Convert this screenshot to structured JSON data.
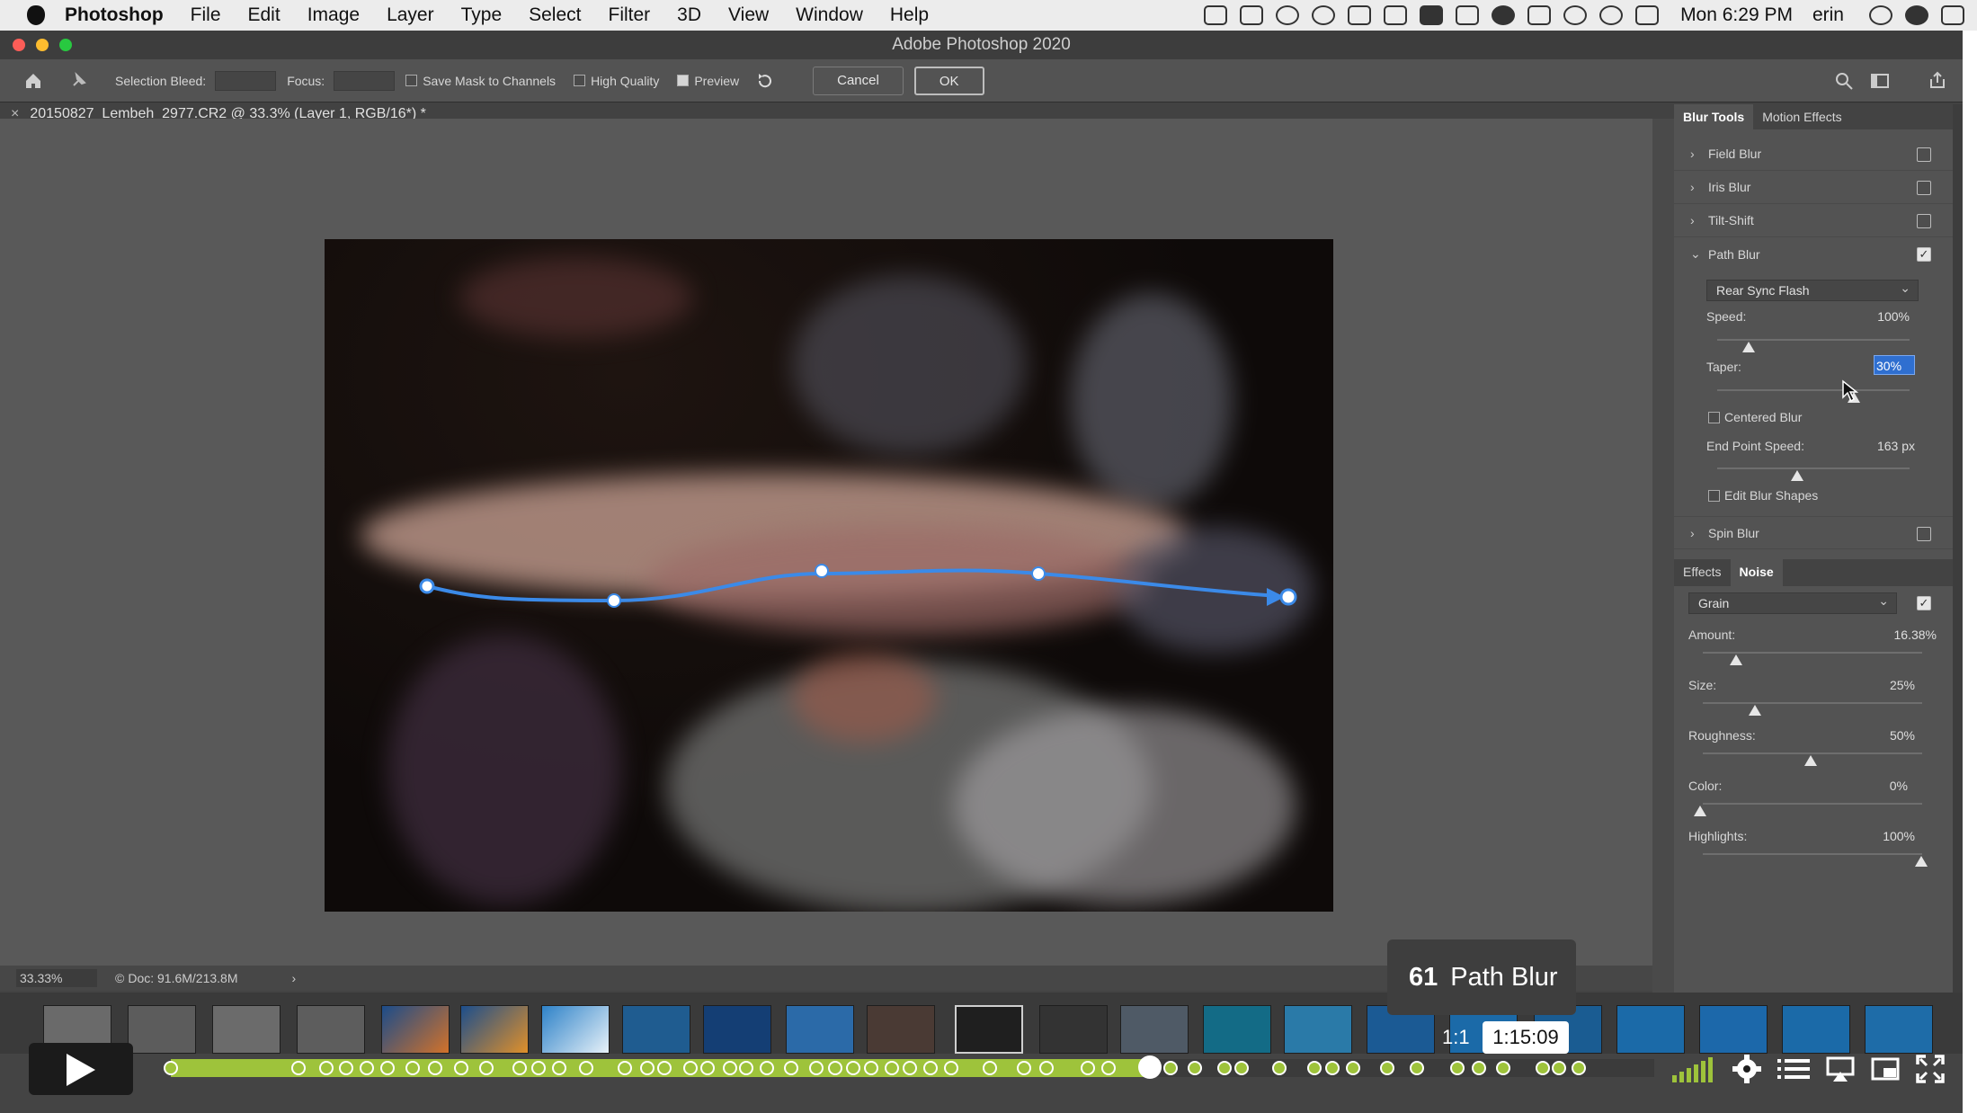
{
  "menubar": {
    "app": "Photoshop",
    "items": [
      "File",
      "Edit",
      "Image",
      "Layer",
      "Type",
      "Select",
      "Filter",
      "3D",
      "View",
      "Window",
      "Help"
    ],
    "clock": "Mon 6:29 PM",
    "user": "erin"
  },
  "window": {
    "title": "Adobe Photoshop 2020"
  },
  "options": {
    "selection_bleed": "Selection Bleed:",
    "focus": "Focus:",
    "save_mask": "Save Mask to Channels",
    "high_quality": "High Quality",
    "preview": "Preview",
    "cancel": "Cancel",
    "ok": "OK"
  },
  "document": {
    "tab": "20150827_Lembeh_2977.CR2 @ 33.3% (Layer 1, RGB/16*) *",
    "zoom": "33.33%",
    "doc_size": "Doc: 91.6M/213.8M"
  },
  "blur_panel": {
    "tabs": [
      "Blur Tools",
      "Motion Effects"
    ],
    "field_blur": "Field Blur",
    "iris_blur": "Iris Blur",
    "tilt_shift": "Tilt-Shift",
    "path_blur": "Path Blur",
    "mode": "Rear Sync Flash",
    "speed_label": "Speed:",
    "speed_value": "100%",
    "speed_level": 1.0,
    "taper_label": "Taper:",
    "taper_value": "30%",
    "taper_level": 0.3,
    "centered_blur": "Centered Blur",
    "end_point_label": "End Point Speed:",
    "end_point_value": "163 px",
    "edit_blur_shapes": "Edit Blur Shapes",
    "spin_blur": "Spin Blur"
  },
  "effects_panel": {
    "tabs": [
      "Effects",
      "Noise"
    ],
    "type": "Grain",
    "amount_label": "Amount:",
    "amount_value": "16.38%",
    "size_label": "Size:",
    "size_value": "25%",
    "roughness_label": "Roughness:",
    "roughness_value": "50%",
    "color_label": "Color:",
    "color_value": "0%",
    "highlights_label": "Highlights:",
    "highlights_value": "100%"
  },
  "player": {
    "chapter_number": "61",
    "chapter_title": "Path Blur",
    "time_partial": "1:1",
    "time": "1:15:09",
    "progress": 0.66,
    "accent": "#9ec33b"
  }
}
